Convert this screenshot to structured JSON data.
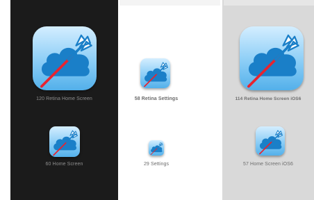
{
  "panels": {
    "dark": {
      "theme": "dark",
      "icons": [
        {
          "label": "120 Retina Home Screen",
          "icon": "cloud-arrow-icon"
        },
        {
          "label": "60 Home Screen",
          "icon": "cloud-arrow-icon"
        }
      ]
    },
    "white": {
      "theme": "light",
      "icons": [
        {
          "label": "58 Retina Settings",
          "icon": "cloud-arrow-icon"
        },
        {
          "label": "29 Settings",
          "icon": "cloud-arrow-icon"
        }
      ]
    },
    "gray": {
      "theme": "gray",
      "icons": [
        {
          "label": "114 Retina Home Screen iOS6",
          "icon": "cloud-arrow-icon"
        },
        {
          "label": "57 Home Screen iOS6",
          "icon": "cloud-arrow-icon"
        }
      ]
    }
  },
  "colors": {
    "dark_bg": "#1b1b1b",
    "gray_bg": "#d9d9d9",
    "cloud": "#1a7fc8",
    "arrow_shaft": "#e8232f",
    "fletching": "#ffffff"
  }
}
